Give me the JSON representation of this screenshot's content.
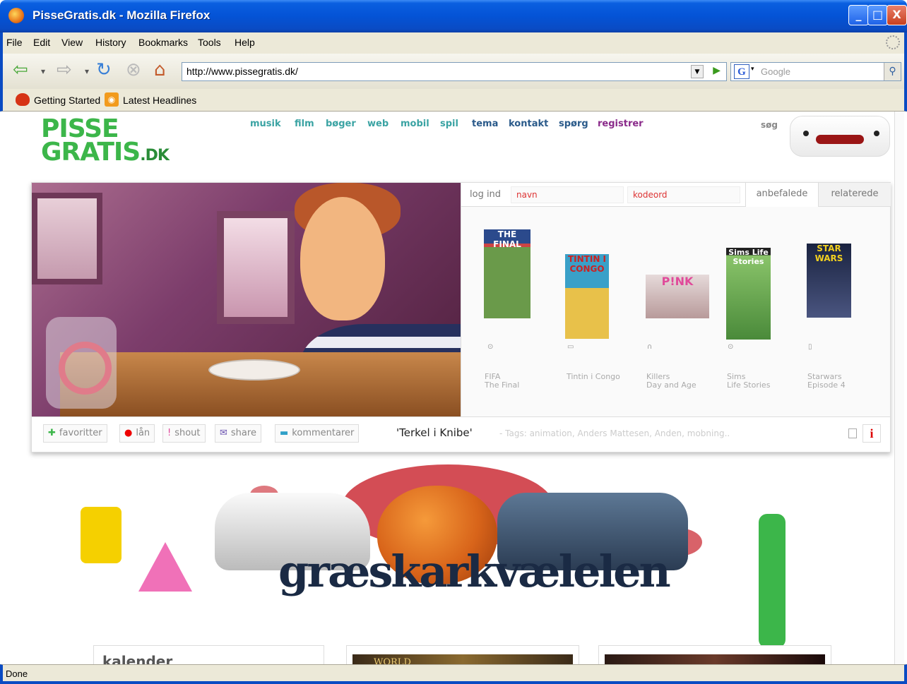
{
  "window": {
    "title": "PisseGratis.dk - Mozilla Firefox",
    "min": "_",
    "max": "□",
    "close": "X"
  },
  "menu": [
    "File",
    "Edit",
    "View",
    "History",
    "Bookmarks",
    "Tools",
    "Help"
  ],
  "nav": {
    "url": "http://www.pissegratis.dk/",
    "search_placeholder": "Google",
    "search_engine_letter": "G"
  },
  "bookmarks": [
    "Getting Started",
    "Latest Headlines"
  ],
  "site": {
    "logo_line1": "PISSE",
    "logo_line2": "GRATIS",
    "logo_suffix": ".DK",
    "nav": [
      {
        "label": "musik",
        "color": "#3aa3a3"
      },
      {
        "label": "film",
        "color": "#3aa3a3"
      },
      {
        "label": "bøger",
        "color": "#3aa3a3"
      },
      {
        "label": "web",
        "color": "#3aa3a3"
      },
      {
        "label": "mobil",
        "color": "#3aa3a3"
      },
      {
        "label": "spil",
        "color": "#3aa3a3"
      },
      {
        "label": "tema",
        "color": "#2a5a8a"
      },
      {
        "label": "kontakt",
        "color": "#2a5a8a"
      },
      {
        "label": "spørg",
        "color": "#2a5a8a"
      },
      {
        "label": "registrer",
        "color": "#8a2a8a"
      }
    ],
    "search_label": "søg"
  },
  "panel": {
    "login_label": "log ind",
    "username_placeholder": "navn",
    "password_placeholder": "kodeord",
    "tabs": [
      "anbefalede",
      "relaterede"
    ],
    "items": [
      {
        "line1": "FIFA",
        "line2": "The Final",
        "type_icon": "disc-icon",
        "cover_text": "THE FINAL",
        "cover_color": "#2b4a8c"
      },
      {
        "line1": "",
        "line2": "Tintin i Congo",
        "type_icon": "book-icon",
        "cover_text": "TINTIN I CONGO",
        "cover_color": "#3aa0c8"
      },
      {
        "line1": "Killers",
        "line2": "Day and Age",
        "type_icon": "headphones-icon",
        "cover_text": "P!NK",
        "cover_color": "#d8c8c8"
      },
      {
        "line1": "Sims",
        "line2": "Life Stories",
        "type_icon": "disc-icon",
        "cover_text": "Sims Life Stories",
        "cover_color": "#4a8a3a"
      },
      {
        "line1": "Starwars",
        "line2": "Episode 4",
        "type_icon": "film-icon",
        "cover_text": "STAR WARS",
        "cover_color": "#1a2340"
      }
    ]
  },
  "actions": {
    "favoritter": "favoritter",
    "laan": "lån",
    "shout": "shout",
    "share": "share",
    "kommentarer": "kommentarer",
    "title": "'Terkel i Knibe'",
    "tags": "- Tags: animation, Anders Mattesen, Anden, mobning..",
    "info": "i"
  },
  "banner_text": "græskarkvælelen",
  "lower": {
    "kalender": "kalender",
    "world": "WORLD"
  },
  "status": "Done"
}
